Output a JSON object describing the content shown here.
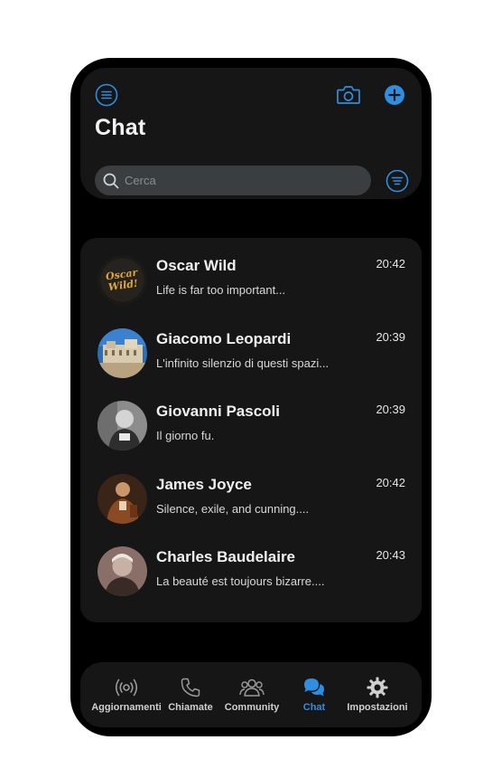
{
  "colors": {
    "accent": "#2f8ee0",
    "background": "#000000",
    "card": "#161616",
    "search_bg": "#3b3e40"
  },
  "header": {
    "menu_icon": "menu-icon",
    "camera_icon": "camera-icon",
    "add_icon": "add-circle-icon",
    "title": "Chat",
    "search_placeholder": "Cerca",
    "filter_icon": "filter-icon"
  },
  "chats": [
    {
      "name": "Oscar Wild",
      "time": "20:42",
      "preview": "Life is far too important..."
    },
    {
      "name": "Giacomo Leopardi",
      "time": "20:39",
      "preview": "L'infinito silenzio di questi spazi..."
    },
    {
      "name": "Giovanni Pascoli",
      "time": "20:39",
      "preview": "Il giorno fu."
    },
    {
      "name": "James Joyce",
      "time": "20:42",
      "preview": "Silence, exile, and cunning...."
    },
    {
      "name": "Charles Baudelaire",
      "time": "20:43",
      "preview": "La beauté est toujours bizarre...."
    }
  ],
  "avatar_text": {
    "oscar": "Oscar Wild!"
  },
  "nav": {
    "items": [
      {
        "label": "Aggiornamenti",
        "icon": "broadcast-icon"
      },
      {
        "label": "Chiamate",
        "icon": "phone-icon"
      },
      {
        "label": "Community",
        "icon": "community-icon"
      },
      {
        "label": "Chat",
        "icon": "chat-bubbles-icon",
        "active": true
      },
      {
        "label": "Impostazioni",
        "icon": "gear-icon"
      }
    ]
  }
}
